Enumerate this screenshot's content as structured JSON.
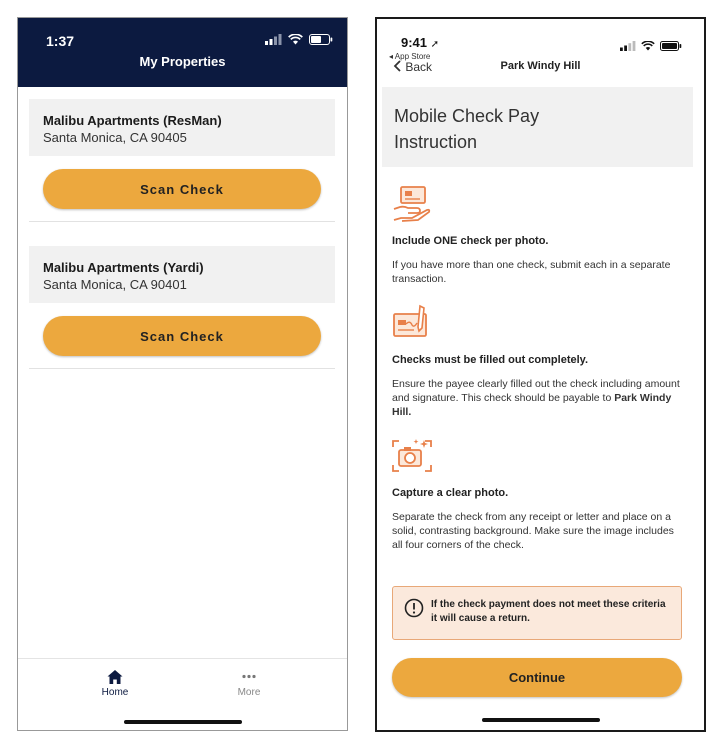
{
  "left": {
    "status_time": "1:37",
    "header_title": "My Properties",
    "properties": [
      {
        "name": "Malibu Apartments (ResMan)",
        "city": "Santa Monica, CA 90405",
        "button_label": "Scan Check"
      },
      {
        "name": "Malibu Apartments (Yardi)",
        "city": "Santa Monica, CA 90401",
        "button_label": "Scan Check"
      }
    ],
    "tabs": [
      {
        "label": "Home",
        "icon": "home-icon",
        "active": true
      },
      {
        "label": "More",
        "icon": "more-dots-icon",
        "active": false
      }
    ],
    "colors": {
      "header_bg": "#0c1a40",
      "button_bg": "#eca83e"
    }
  },
  "right": {
    "status_time": "9:41",
    "back_app_label": "App Store",
    "back_label": "Back",
    "nav_title": "Park Windy Hill",
    "heading_line1": "Mobile Check Pay",
    "heading_line2": "Instruction",
    "instructions": [
      {
        "icon": "hand-check-icon",
        "title": "Include ONE check per photo.",
        "body": "If you have more than one check, submit each in a separate transaction."
      },
      {
        "icon": "filled-check-pen-icon",
        "title": "Checks must be filled out completely.",
        "body": "Ensure the payee clearly filled out the check including amount and signature. This check should be payable to",
        "body_bold": "Park Windy Hill."
      },
      {
        "icon": "camera-icon",
        "title": "Capture a clear photo.",
        "body": "Separate the check from any receipt or letter and place on a solid, contrasting background. Make sure the image includes all four corners of the check."
      }
    ],
    "warning": "If the check payment does not meet these criteria it will cause a return.",
    "continue_label": "Continue",
    "colors": {
      "accent_orange": "#e8804a",
      "warning_bg": "#fbe9dc",
      "button_bg": "#eca83e"
    }
  }
}
